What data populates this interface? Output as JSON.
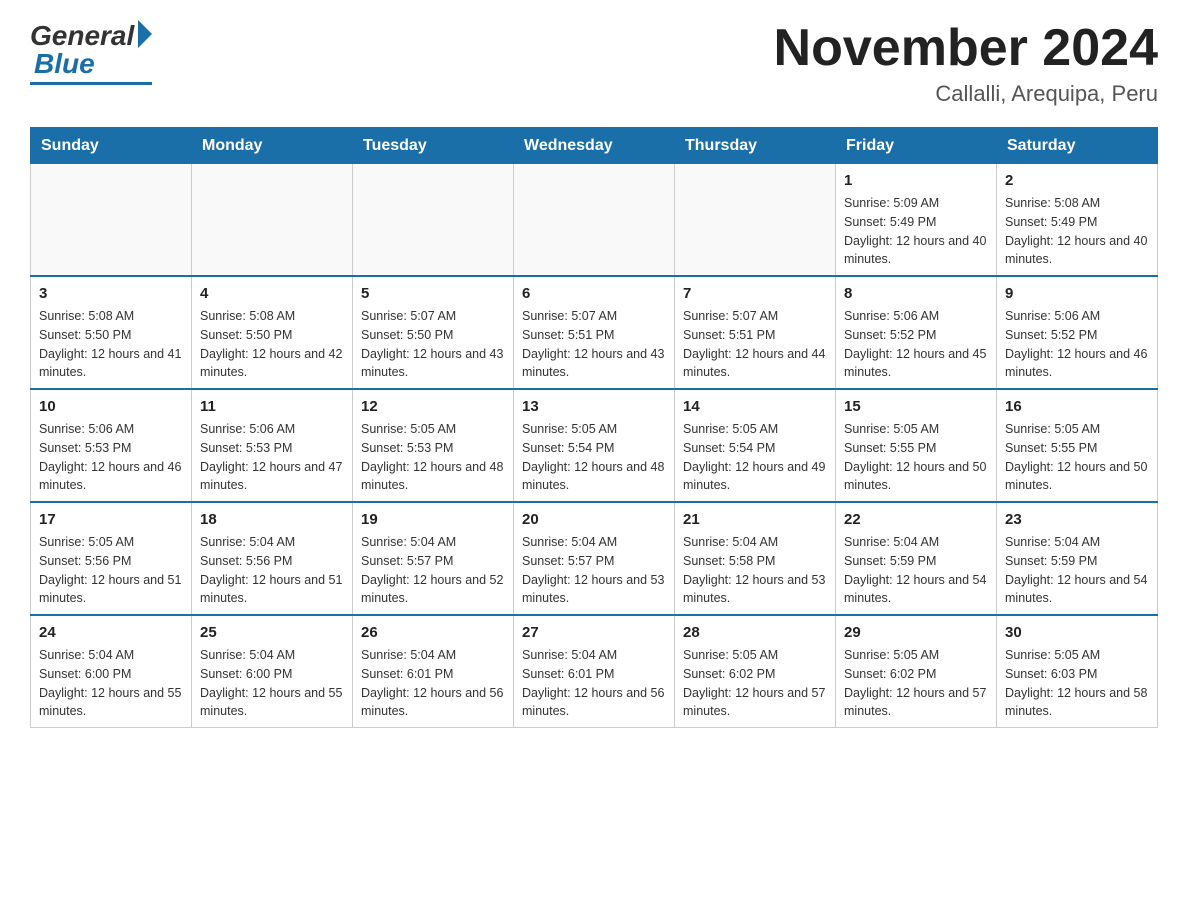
{
  "header": {
    "logo": {
      "general": "General",
      "blue": "Blue"
    },
    "title": "November 2024",
    "subtitle": "Callalli, Arequipa, Peru"
  },
  "days_of_week": [
    "Sunday",
    "Monday",
    "Tuesday",
    "Wednesday",
    "Thursday",
    "Friday",
    "Saturday"
  ],
  "weeks": [
    [
      {
        "day": "",
        "info": ""
      },
      {
        "day": "",
        "info": ""
      },
      {
        "day": "",
        "info": ""
      },
      {
        "day": "",
        "info": ""
      },
      {
        "day": "",
        "info": ""
      },
      {
        "day": "1",
        "info": "Sunrise: 5:09 AM\nSunset: 5:49 PM\nDaylight: 12 hours and 40 minutes."
      },
      {
        "day": "2",
        "info": "Sunrise: 5:08 AM\nSunset: 5:49 PM\nDaylight: 12 hours and 40 minutes."
      }
    ],
    [
      {
        "day": "3",
        "info": "Sunrise: 5:08 AM\nSunset: 5:50 PM\nDaylight: 12 hours and 41 minutes."
      },
      {
        "day": "4",
        "info": "Sunrise: 5:08 AM\nSunset: 5:50 PM\nDaylight: 12 hours and 42 minutes."
      },
      {
        "day": "5",
        "info": "Sunrise: 5:07 AM\nSunset: 5:50 PM\nDaylight: 12 hours and 43 minutes."
      },
      {
        "day": "6",
        "info": "Sunrise: 5:07 AM\nSunset: 5:51 PM\nDaylight: 12 hours and 43 minutes."
      },
      {
        "day": "7",
        "info": "Sunrise: 5:07 AM\nSunset: 5:51 PM\nDaylight: 12 hours and 44 minutes."
      },
      {
        "day": "8",
        "info": "Sunrise: 5:06 AM\nSunset: 5:52 PM\nDaylight: 12 hours and 45 minutes."
      },
      {
        "day": "9",
        "info": "Sunrise: 5:06 AM\nSunset: 5:52 PM\nDaylight: 12 hours and 46 minutes."
      }
    ],
    [
      {
        "day": "10",
        "info": "Sunrise: 5:06 AM\nSunset: 5:53 PM\nDaylight: 12 hours and 46 minutes."
      },
      {
        "day": "11",
        "info": "Sunrise: 5:06 AM\nSunset: 5:53 PM\nDaylight: 12 hours and 47 minutes."
      },
      {
        "day": "12",
        "info": "Sunrise: 5:05 AM\nSunset: 5:53 PM\nDaylight: 12 hours and 48 minutes."
      },
      {
        "day": "13",
        "info": "Sunrise: 5:05 AM\nSunset: 5:54 PM\nDaylight: 12 hours and 48 minutes."
      },
      {
        "day": "14",
        "info": "Sunrise: 5:05 AM\nSunset: 5:54 PM\nDaylight: 12 hours and 49 minutes."
      },
      {
        "day": "15",
        "info": "Sunrise: 5:05 AM\nSunset: 5:55 PM\nDaylight: 12 hours and 50 minutes."
      },
      {
        "day": "16",
        "info": "Sunrise: 5:05 AM\nSunset: 5:55 PM\nDaylight: 12 hours and 50 minutes."
      }
    ],
    [
      {
        "day": "17",
        "info": "Sunrise: 5:05 AM\nSunset: 5:56 PM\nDaylight: 12 hours and 51 minutes."
      },
      {
        "day": "18",
        "info": "Sunrise: 5:04 AM\nSunset: 5:56 PM\nDaylight: 12 hours and 51 minutes."
      },
      {
        "day": "19",
        "info": "Sunrise: 5:04 AM\nSunset: 5:57 PM\nDaylight: 12 hours and 52 minutes."
      },
      {
        "day": "20",
        "info": "Sunrise: 5:04 AM\nSunset: 5:57 PM\nDaylight: 12 hours and 53 minutes."
      },
      {
        "day": "21",
        "info": "Sunrise: 5:04 AM\nSunset: 5:58 PM\nDaylight: 12 hours and 53 minutes."
      },
      {
        "day": "22",
        "info": "Sunrise: 5:04 AM\nSunset: 5:59 PM\nDaylight: 12 hours and 54 minutes."
      },
      {
        "day": "23",
        "info": "Sunrise: 5:04 AM\nSunset: 5:59 PM\nDaylight: 12 hours and 54 minutes."
      }
    ],
    [
      {
        "day": "24",
        "info": "Sunrise: 5:04 AM\nSunset: 6:00 PM\nDaylight: 12 hours and 55 minutes."
      },
      {
        "day": "25",
        "info": "Sunrise: 5:04 AM\nSunset: 6:00 PM\nDaylight: 12 hours and 55 minutes."
      },
      {
        "day": "26",
        "info": "Sunrise: 5:04 AM\nSunset: 6:01 PM\nDaylight: 12 hours and 56 minutes."
      },
      {
        "day": "27",
        "info": "Sunrise: 5:04 AM\nSunset: 6:01 PM\nDaylight: 12 hours and 56 minutes."
      },
      {
        "day": "28",
        "info": "Sunrise: 5:05 AM\nSunset: 6:02 PM\nDaylight: 12 hours and 57 minutes."
      },
      {
        "day": "29",
        "info": "Sunrise: 5:05 AM\nSunset: 6:02 PM\nDaylight: 12 hours and 57 minutes."
      },
      {
        "day": "30",
        "info": "Sunrise: 5:05 AM\nSunset: 6:03 PM\nDaylight: 12 hours and 58 minutes."
      }
    ]
  ]
}
